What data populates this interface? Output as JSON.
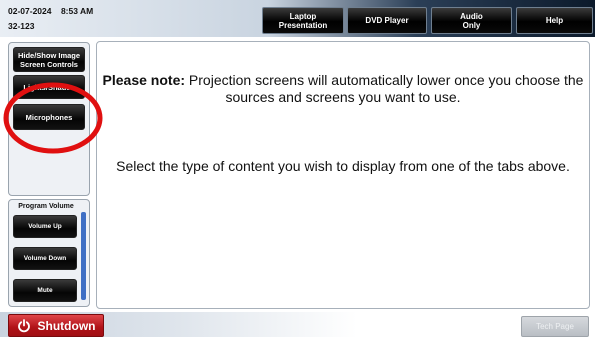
{
  "header": {
    "date": "02-07-2024",
    "time": "8:53 AM",
    "room": "32-123",
    "tabs": [
      {
        "label": "Laptop\nPresentation"
      },
      {
        "label": "DVD Player"
      },
      {
        "label": "Audio\nOnly"
      },
      {
        "label": "Help"
      }
    ]
  },
  "sidebar": {
    "buttons": [
      {
        "label": "Hide/Show Image\nScreen Controls"
      },
      {
        "label": "Lights/Shades"
      },
      {
        "label": "Microphones"
      }
    ]
  },
  "volume": {
    "title": "Program Volume",
    "up_label": "Volume Up",
    "down_label": "Volume Down",
    "mute_label": "Mute"
  },
  "main": {
    "note_bold": "Please note:",
    "note_text": " Projection screens will automatically lower once you choose the sources and screens you want to use.",
    "select_text": "Select the type of content you wish to display from one of the tabs above."
  },
  "footer": {
    "shutdown_label": "Shutdown",
    "tech_label": "Tech Page"
  },
  "colors": {
    "shutdown": "#b01217",
    "annotation": "#e01010",
    "volume_bar": "#3f6fc4"
  },
  "icons": {
    "power": "power-icon"
  }
}
